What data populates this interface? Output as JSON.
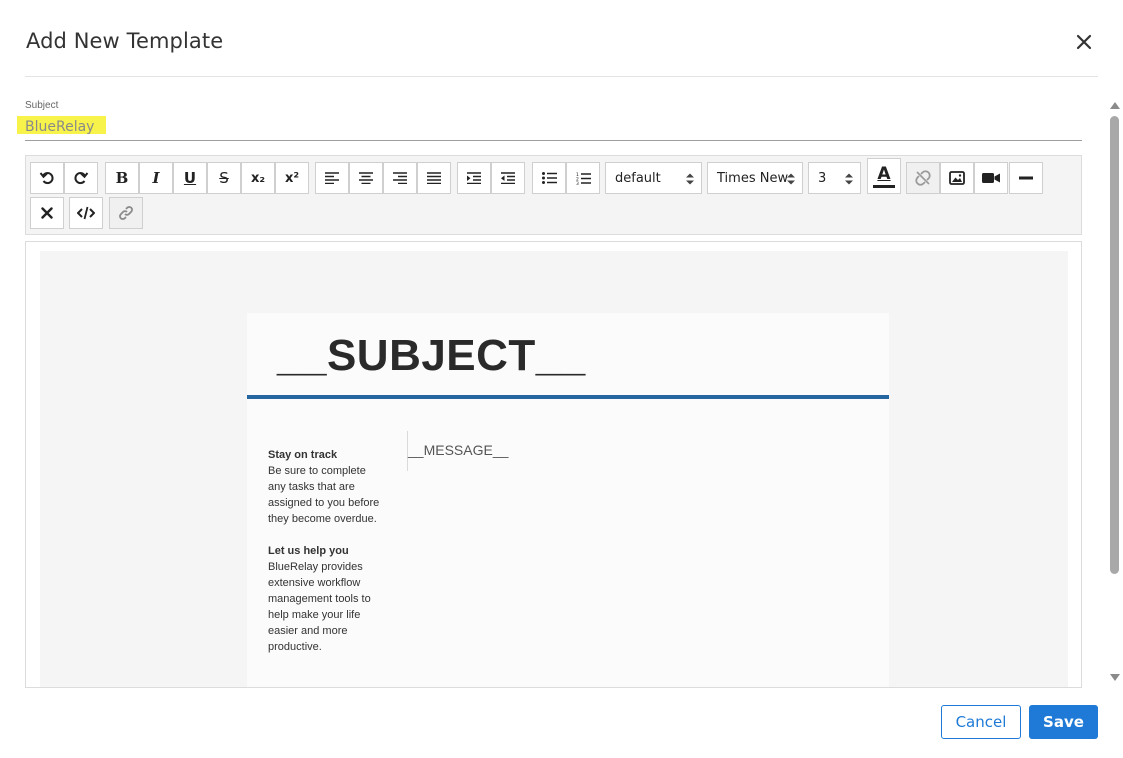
{
  "dialog": {
    "title": "Add New Template",
    "cancel_label": "Cancel",
    "save_label": "Save"
  },
  "subject": {
    "label": "Subject",
    "value": "BlueRelay"
  },
  "toolbar": {
    "bold": "B",
    "italic": "I",
    "underline": "U",
    "strikethrough": "S",
    "subscript": "x₂",
    "superscript": "x²",
    "format_select": "default",
    "font_select": "Times New",
    "size_select": "3",
    "font_color": "A"
  },
  "template": {
    "heading": "__SUBJECT__",
    "message": "__MESSAGE__",
    "sidebar": [
      {
        "heading": "Stay on track",
        "lines": [
          "Be sure to complete",
          "any tasks that are",
          "assigned to you before",
          "they become overdue."
        ]
      },
      {
        "heading": "Let us help you",
        "lines": [
          "BlueRelay provides",
          "extensive workflow",
          "management tools to",
          "help make your life",
          "easier and more",
          "productive."
        ]
      }
    ]
  },
  "colors": {
    "primary": "#1e7ad6",
    "rule": "#2566a0",
    "highlight": "#f7f34a"
  }
}
